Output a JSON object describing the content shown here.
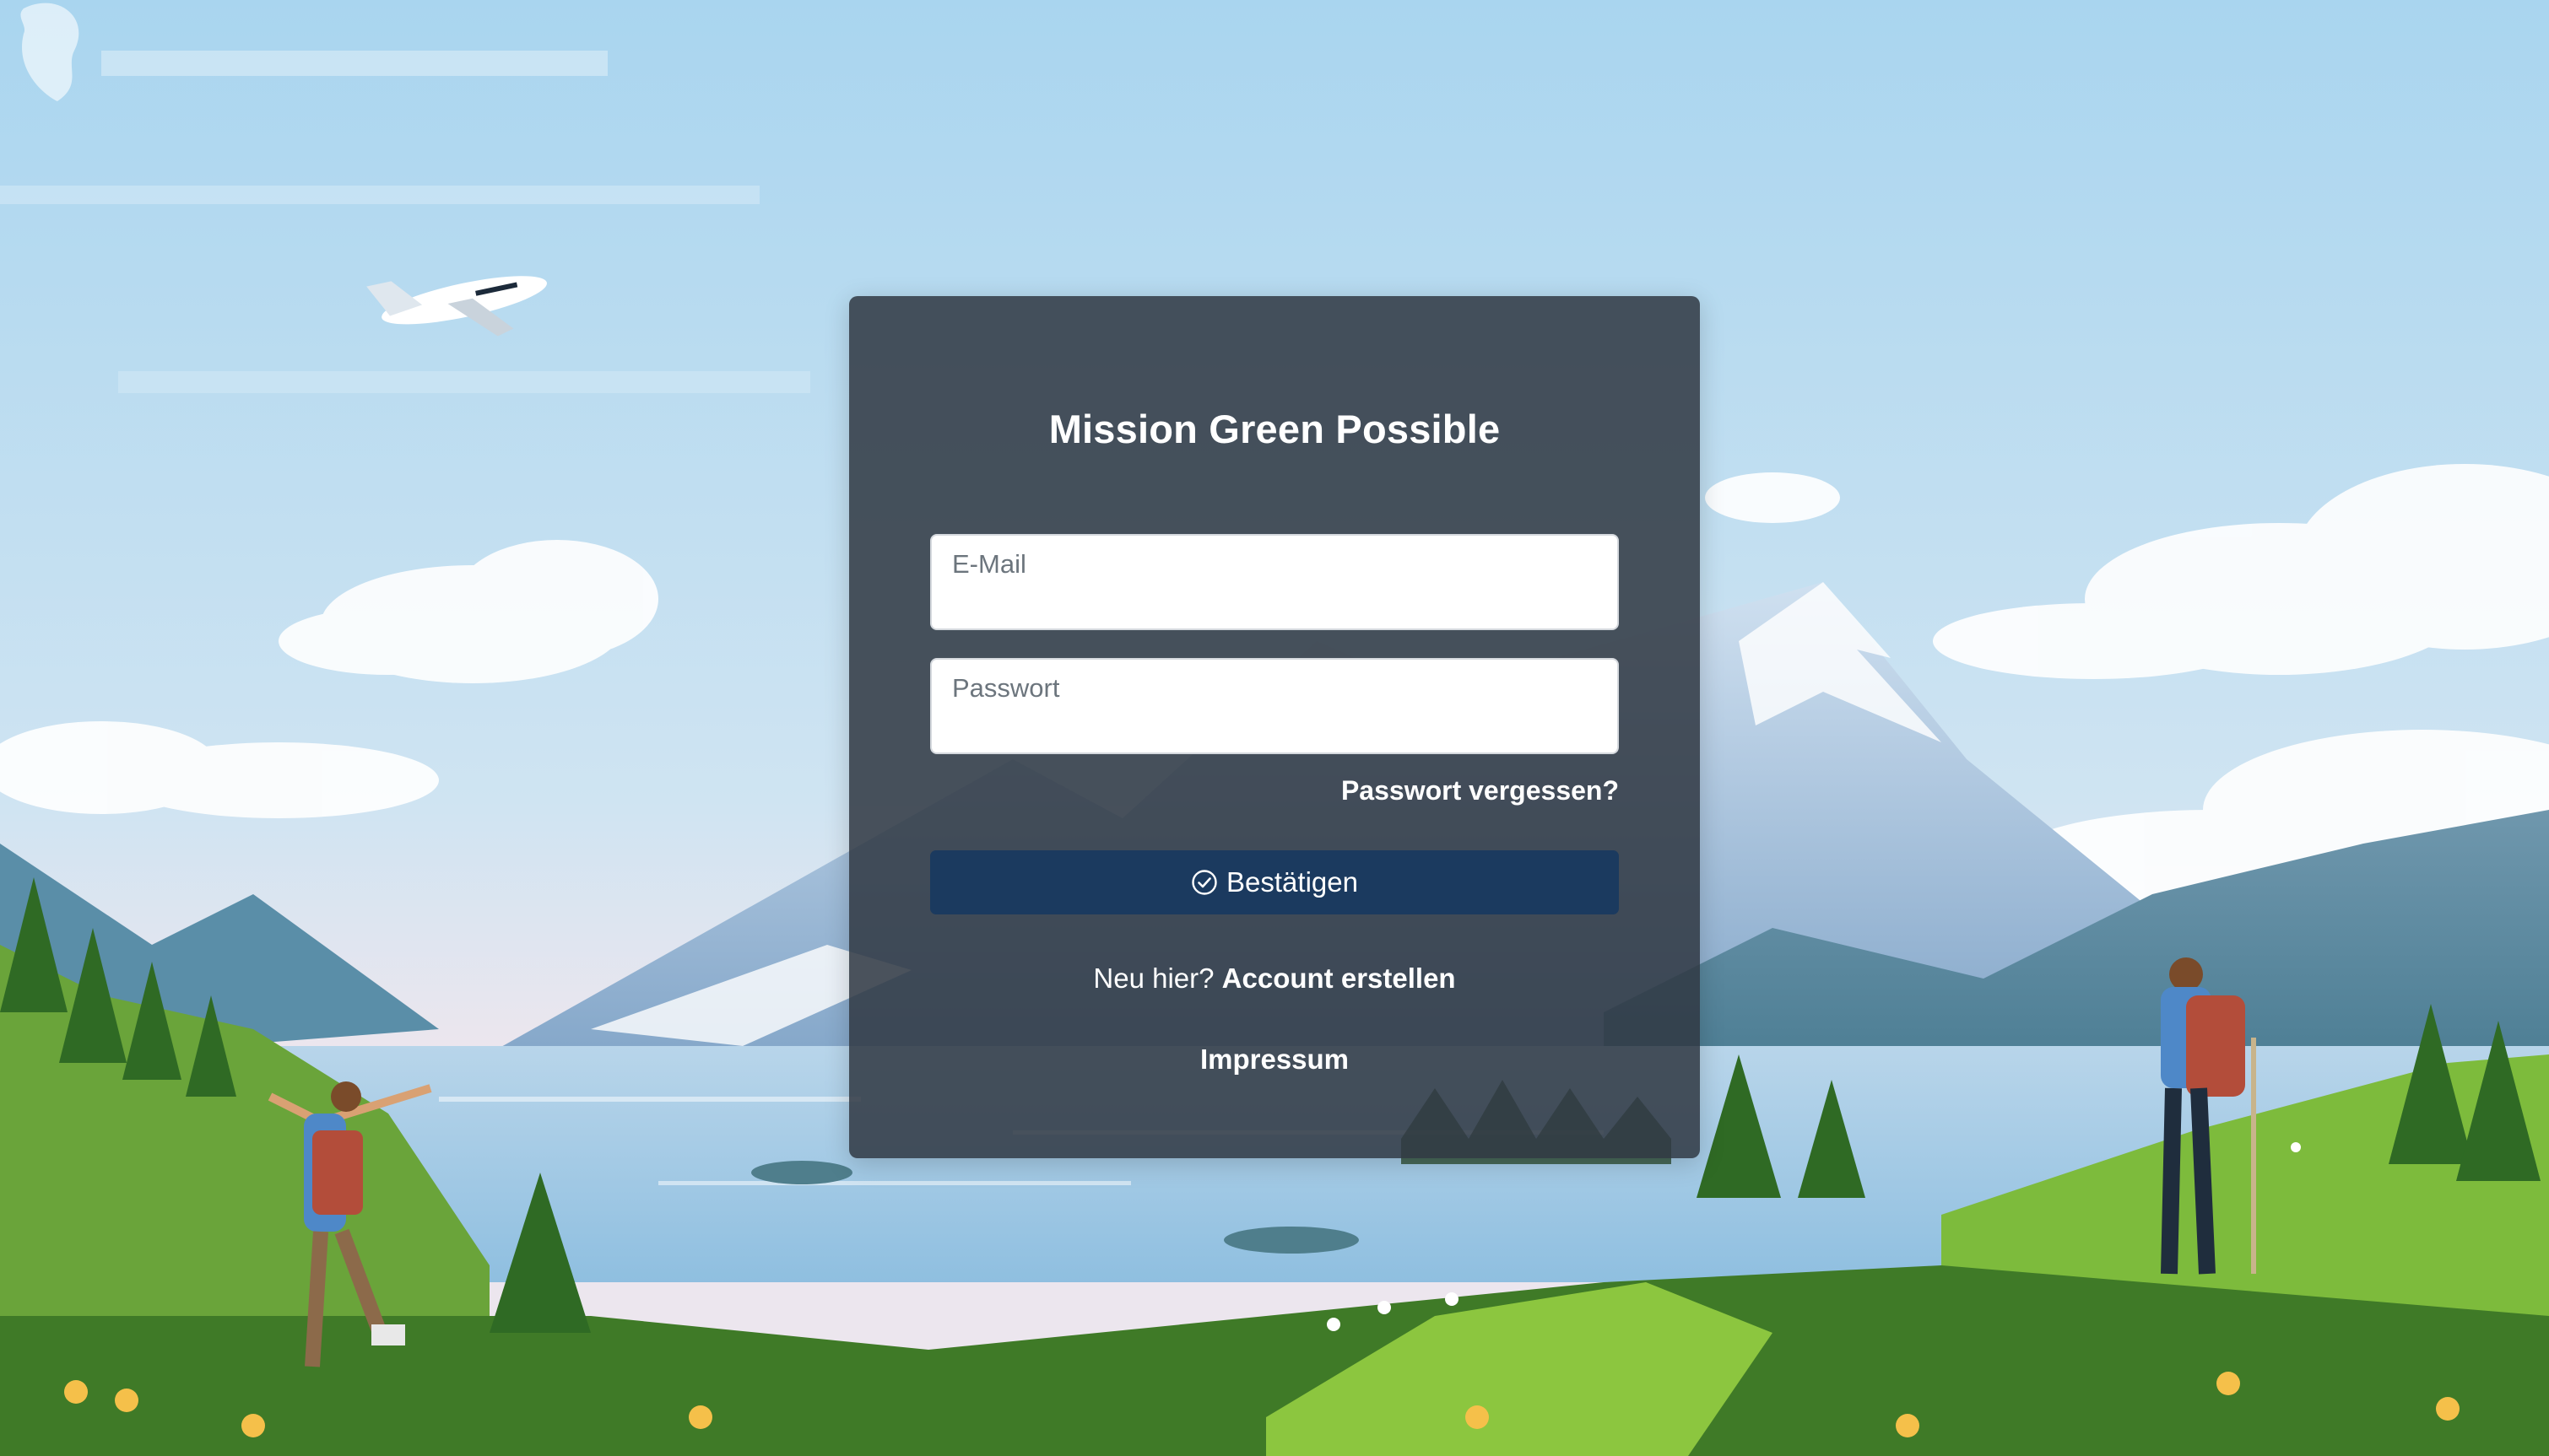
{
  "app": {
    "title": "Mission Green Possible"
  },
  "login": {
    "email_label": "E-Mail",
    "email_value": "",
    "password_label": "Passwort",
    "password_value": "",
    "forgot_label": "Passwort vergessen?",
    "submit_label": "Bestätigen",
    "submit_icon": "check-circle-icon",
    "new_here_text": "Neu hier?",
    "create_account_label": "Account erstellen",
    "impressum_label": "Impressum"
  },
  "colors": {
    "card_bg": "#303842",
    "button_bg": "#1b3a5f",
    "text": "#ffffff",
    "sky": "#b6d9ee",
    "grass": "#5d9a34"
  }
}
